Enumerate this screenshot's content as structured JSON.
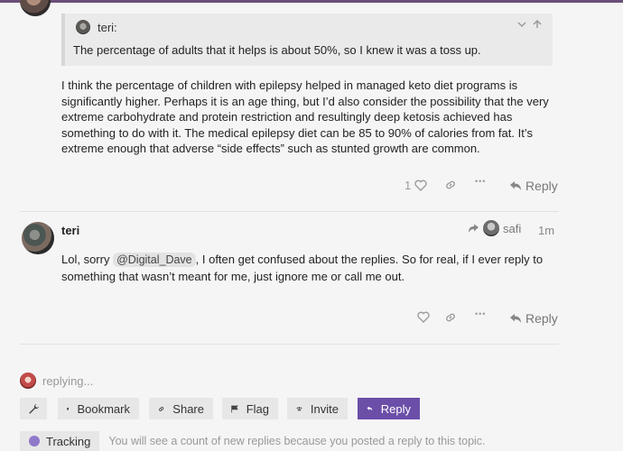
{
  "quote": {
    "author": "teri:",
    "text": "The percentage of adults that it helps is about 50%, so I knew it was a toss up."
  },
  "post1": {
    "body": "I think the percentage of children with epilepsy helped in managed keto diet programs is significantly higher. Perhaps it is an age thing, but I’d also consider the possibility that the very extreme carbohydrate and protein restriction and resultingly deep ketosis achieved has something to do with it. The medical epilepsy diet can be 85 to 90% of calories from fat. It’s extreme enough that adverse “side effects” such as stunted growth are common.",
    "like_count": "1",
    "more_icon": "•••",
    "reply_label": "Reply"
  },
  "post2": {
    "author": "teri",
    "reply_to": "safi",
    "time": "1m",
    "body_before": "Lol, sorry ",
    "mention": "@Digital_Dave",
    "body_after": ", I often get confused about the replies. So for real, if I ever reply to something that wasn’t meant for me, just ignore me or call me out.",
    "more_icon": "•••",
    "reply_label": "Reply"
  },
  "footer": {
    "replying": "replying...",
    "buttons": {
      "bookmark": "Bookmark",
      "share": "Share",
      "flag": "Flag",
      "invite": "Invite",
      "reply": "Reply"
    },
    "tracking_label": "Tracking",
    "tracking_desc": "You will see a count of new replies because you posted a reply to this topic."
  },
  "colors": {
    "accent": "#6b4ea8",
    "tracking_dot": "#8f79c9",
    "background": "#f6f5f6"
  },
  "icons": [
    "heart-icon",
    "link-icon",
    "more-icon",
    "reply-icon",
    "wrench-icon",
    "bookmark-icon",
    "share-link-icon",
    "flag-icon",
    "invite-icon",
    "chevron-down-icon",
    "arrow-up-icon"
  ]
}
